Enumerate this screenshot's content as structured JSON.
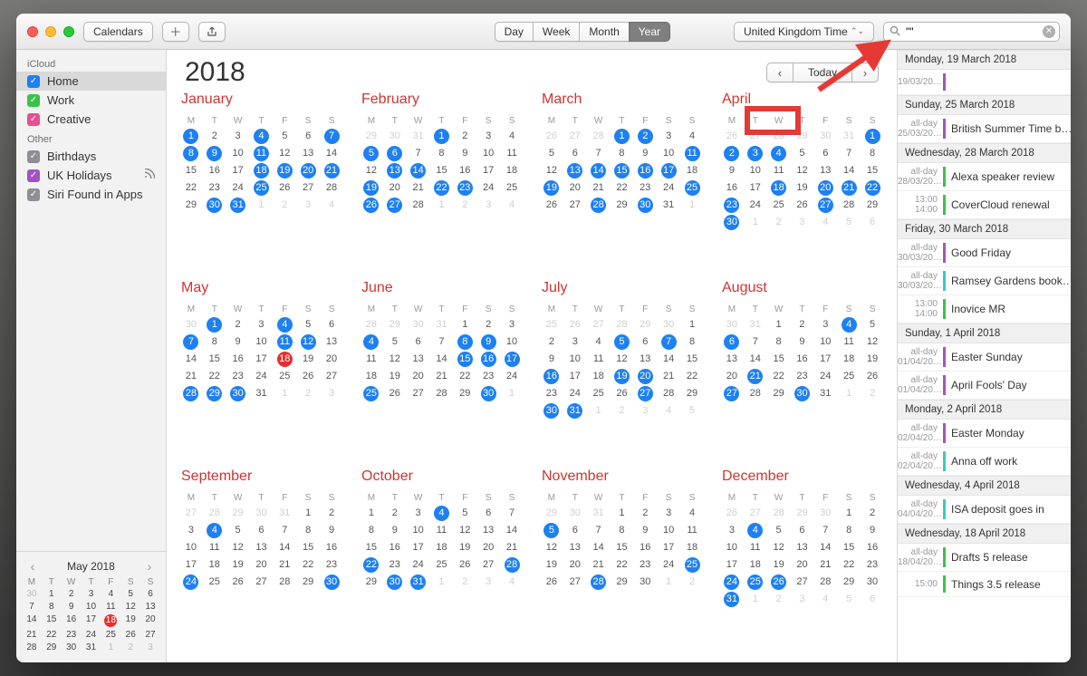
{
  "toolbar": {
    "calendars_btn": "Calendars",
    "views": [
      "Day",
      "Week",
      "Month",
      "Year"
    ],
    "active_view": 3,
    "timezone": "United Kingdom Time",
    "search_value": "\"\""
  },
  "sidebar": {
    "groups": [
      {
        "title": "iCloud",
        "items": [
          {
            "label": "Home",
            "color": "#1D80F3",
            "selected": true
          },
          {
            "label": "Work",
            "color": "#3CC24B"
          },
          {
            "label": "Creative",
            "color": "#E84F90"
          }
        ]
      },
      {
        "title": "Other",
        "items": [
          {
            "label": "Birthdays",
            "color": "#8E8E93"
          },
          {
            "label": "UK Holidays",
            "color": "#A452C4",
            "rss": true
          },
          {
            "label": "Siri Found in Apps",
            "color": "#8E8E93"
          }
        ]
      }
    ],
    "mini": {
      "title": "May 2018",
      "headers": [
        "M",
        "T",
        "W",
        "T",
        "F",
        "S",
        "S"
      ],
      "leading": [
        30
      ],
      "days": 31,
      "today": 18,
      "trailing": [
        1,
        2,
        3
      ]
    }
  },
  "main": {
    "year": "2018",
    "today_btn": "Today",
    "day_headers": [
      "M",
      "T",
      "W",
      "T",
      "F",
      "S",
      "S"
    ],
    "months": [
      {
        "name": "January",
        "start": 0,
        "days": 31,
        "prev": 0,
        "events": [
          1,
          4,
          7,
          8,
          9,
          11,
          18,
          19,
          20,
          21,
          25,
          30,
          31
        ]
      },
      {
        "name": "February",
        "start": 3,
        "days": 28,
        "prev": 0,
        "events": [
          1,
          5,
          6,
          13,
          14,
          19,
          22,
          23,
          26,
          27
        ]
      },
      {
        "name": "March",
        "start": 3,
        "days": 31,
        "prev": 0,
        "events": [
          1,
          2,
          11,
          13,
          14,
          15,
          16,
          17,
          19,
          25,
          28,
          30
        ]
      },
      {
        "name": "April",
        "start": 6,
        "days": 30,
        "prev": 0,
        "events": [
          1,
          2,
          3,
          4,
          18,
          20,
          21,
          22,
          23,
          27,
          30
        ]
      },
      {
        "name": "May",
        "start": 1,
        "days": 31,
        "prev": 0,
        "events": [
          1,
          4,
          7,
          11,
          12,
          28,
          29,
          30
        ],
        "today": 18
      },
      {
        "name": "June",
        "start": 4,
        "days": 30,
        "prev": 0,
        "events": [
          4,
          8,
          9,
          15,
          16,
          17,
          25,
          30
        ]
      },
      {
        "name": "July",
        "start": 6,
        "days": 31,
        "prev": 0,
        "events": [
          5,
          7,
          16,
          19,
          20,
          27,
          30,
          31
        ]
      },
      {
        "name": "August",
        "start": 2,
        "days": 31,
        "prev": 0,
        "events": [
          4,
          6,
          21,
          27,
          30
        ]
      },
      {
        "name": "September",
        "start": 5,
        "days": 30,
        "prev": 0,
        "events": [
          4,
          24,
          30
        ]
      },
      {
        "name": "October",
        "start": 0,
        "days": 31,
        "prev": 0,
        "events": [
          4,
          22,
          28,
          30,
          31
        ]
      },
      {
        "name": "November",
        "start": 3,
        "days": 30,
        "prev": 0,
        "events": [
          5,
          25,
          28
        ]
      },
      {
        "name": "December",
        "start": 5,
        "days": 31,
        "prev": 0,
        "events": [
          4,
          24,
          25,
          26,
          31
        ]
      }
    ]
  },
  "results": [
    {
      "date": "Monday, 19 March 2018",
      "items": [
        {
          "time": "",
          "sub": "19/03/20…",
          "color": "#A452C4",
          "title": ""
        }
      ]
    },
    {
      "date": "Sunday, 25 March 2018",
      "items": [
        {
          "time": "all-day",
          "sub": "25/03/20…",
          "color": "#A452C4",
          "title": "British Summer Time b…"
        }
      ]
    },
    {
      "date": "Wednesday, 28 March 2018",
      "items": [
        {
          "time": "all-day",
          "sub": "28/03/20…",
          "color": "#3CC24B",
          "title": "Alexa speaker review"
        },
        {
          "time": "13:00",
          "sub": "14:00",
          "color": "#3CC24B",
          "title": "CoverCloud renewal"
        }
      ]
    },
    {
      "date": "Friday, 30 March 2018",
      "items": [
        {
          "time": "all-day",
          "sub": "30/03/20…",
          "color": "#A452C4",
          "title": "Good Friday"
        },
        {
          "time": "all-day",
          "sub": "30/03/20…",
          "color": "#3BC8C8",
          "title": "Ramsey Gardens book…"
        },
        {
          "time": "13:00",
          "sub": "14:00",
          "color": "#3CC24B",
          "title": "Inovice MR"
        }
      ]
    },
    {
      "date": "Sunday, 1 April 2018",
      "items": [
        {
          "time": "all-day",
          "sub": "01/04/20…",
          "color": "#A452C4",
          "title": "Easter Sunday"
        },
        {
          "time": "all-day",
          "sub": "01/04/20…",
          "color": "#A452C4",
          "title": "April Fools' Day"
        }
      ]
    },
    {
      "date": "Monday, 2 April 2018",
      "items": [
        {
          "time": "all-day",
          "sub": "02/04/20…",
          "color": "#A452C4",
          "title": "Easter Monday"
        },
        {
          "time": "all-day",
          "sub": "02/04/20…",
          "color": "#3BC8C8",
          "title": "Anna off work"
        }
      ]
    },
    {
      "date": "Wednesday, 4 April 2018",
      "items": [
        {
          "time": "all-day",
          "sub": "04/04/20…",
          "color": "#3BC8C8",
          "title": "ISA deposit goes in"
        }
      ]
    },
    {
      "date": "Wednesday, 18 April 2018",
      "items": [
        {
          "time": "all-day",
          "sub": "18/04/20…",
          "color": "#3CC24B",
          "title": "Drafts 5 release"
        },
        {
          "time": "15:00",
          "sub": "",
          "color": "#3CC24B",
          "title": "Things 3.5 release"
        }
      ]
    }
  ]
}
